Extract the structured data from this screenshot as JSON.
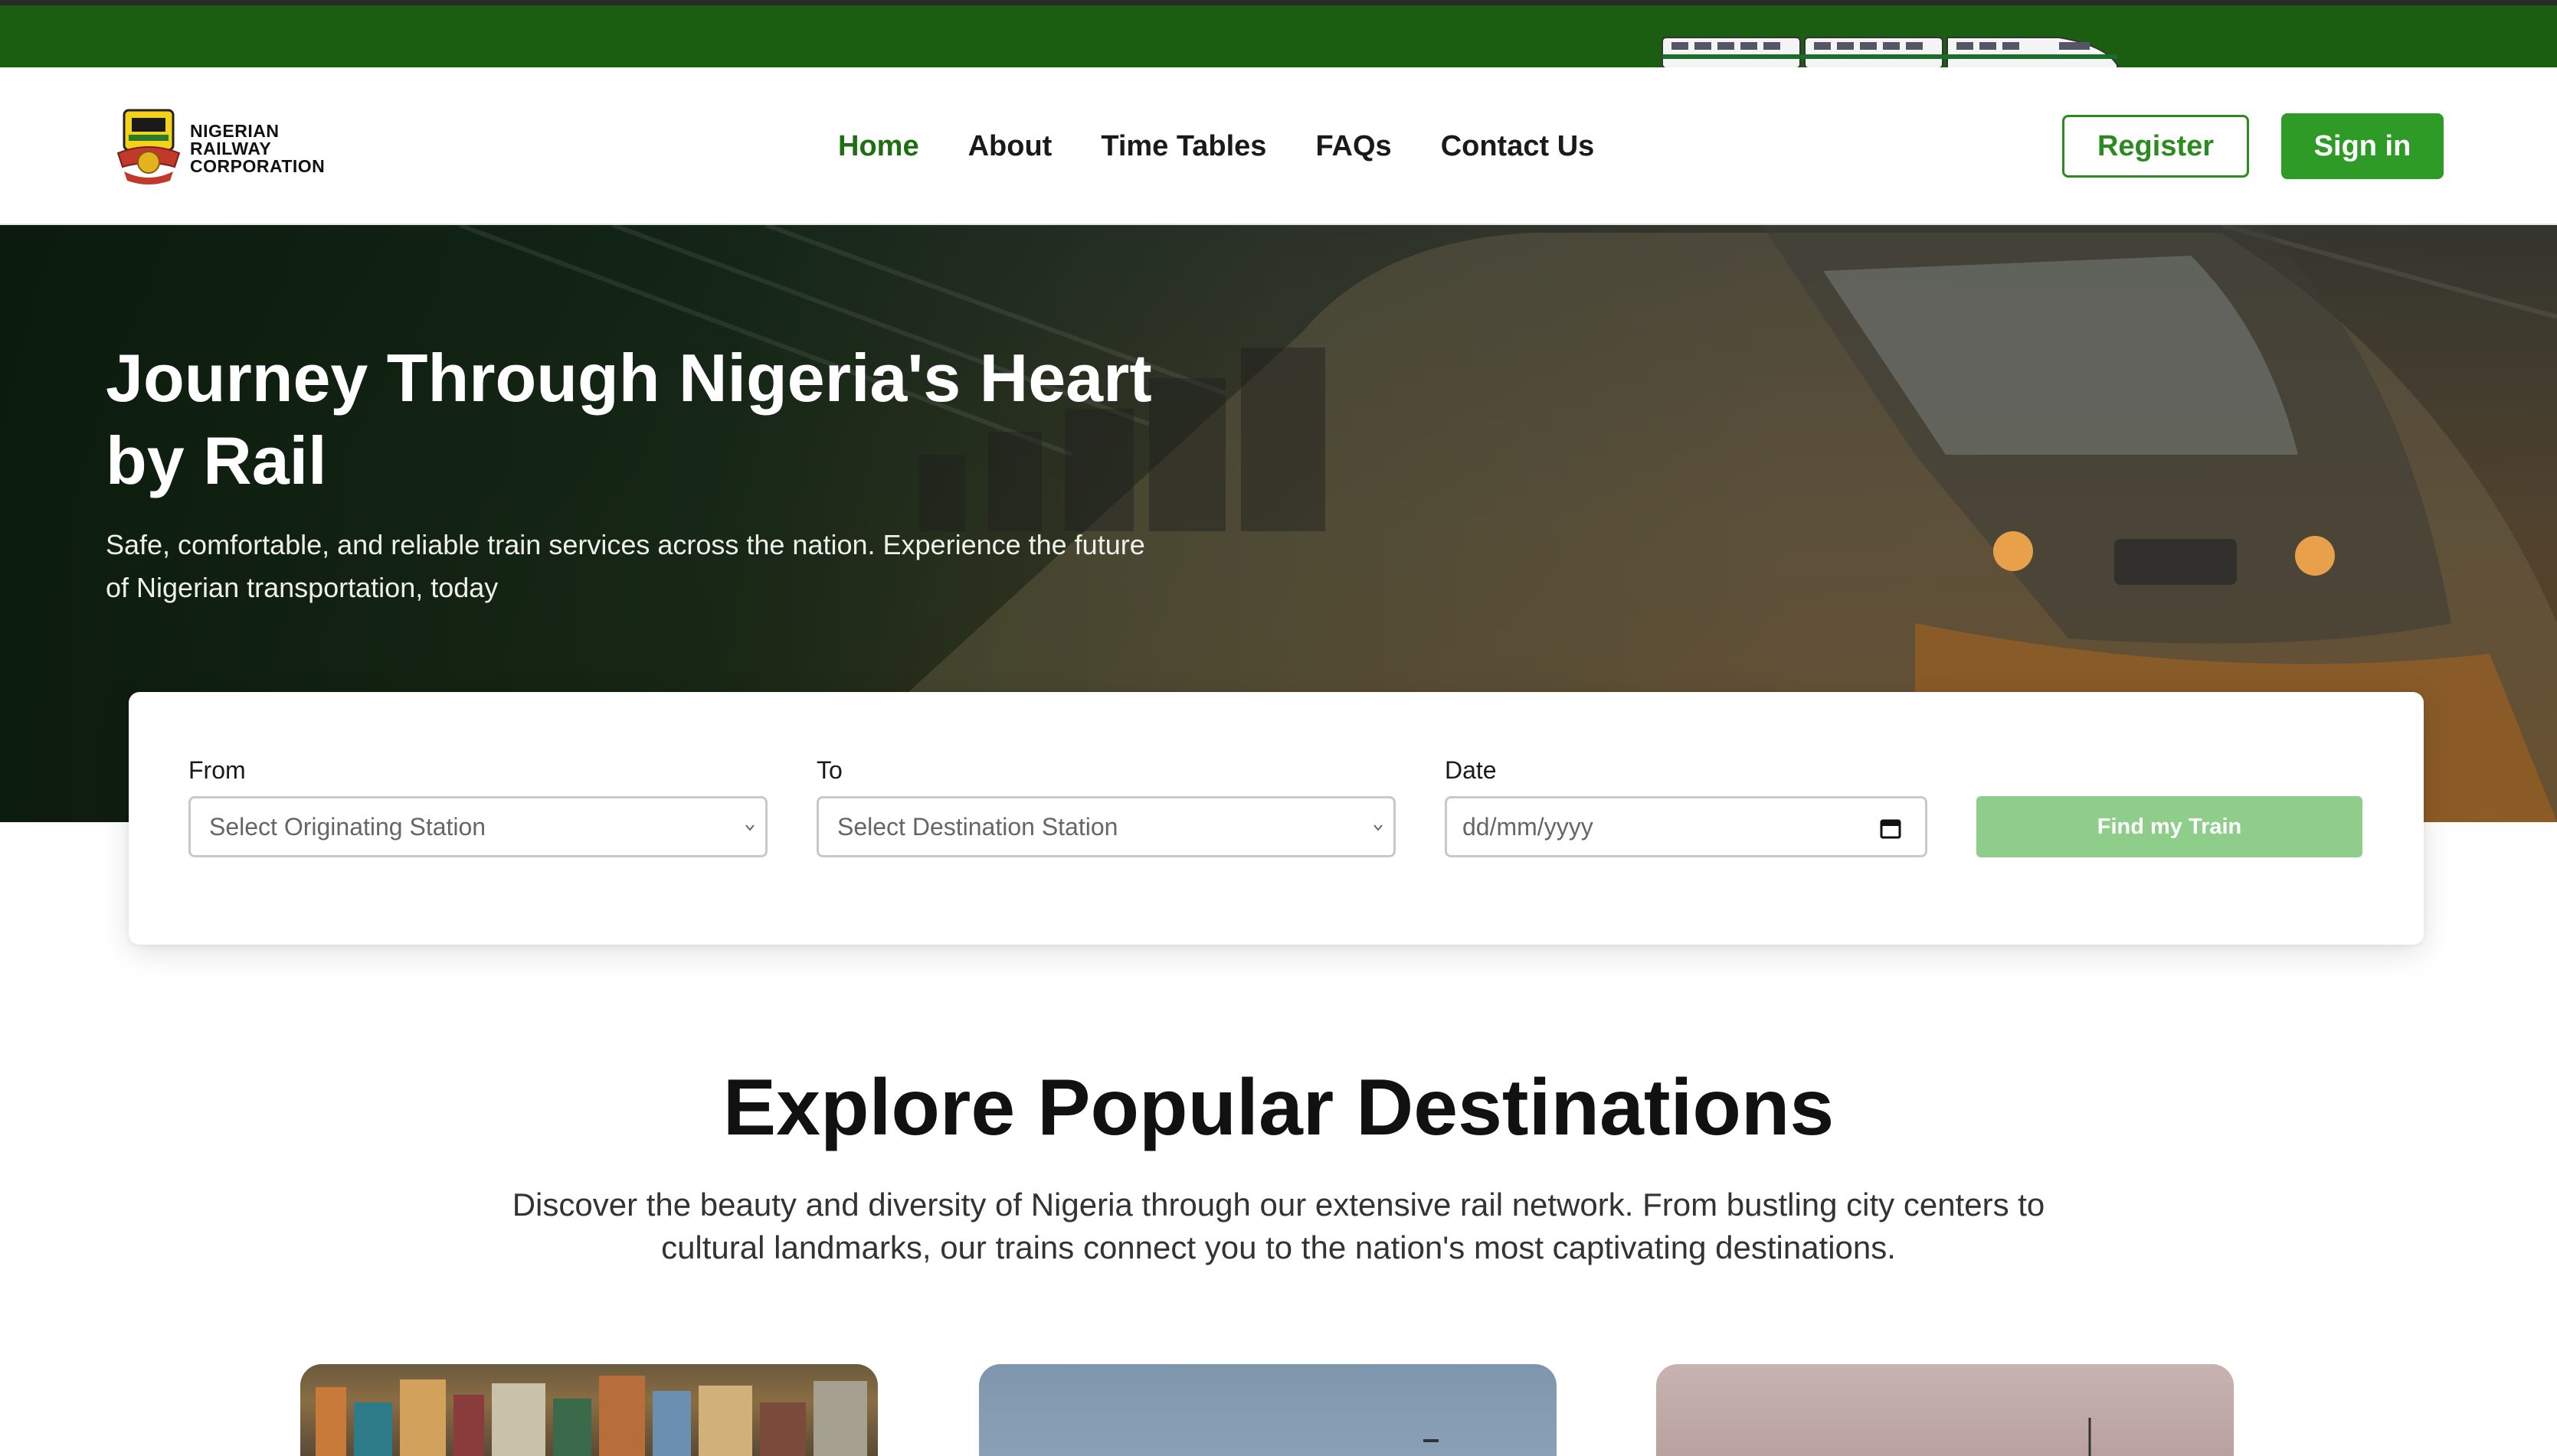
{
  "brand": {
    "logo_lines": [
      "NIGERIAN",
      "RAILWAY",
      "CORPORATION"
    ]
  },
  "nav": {
    "links": [
      {
        "label": "Home",
        "active": true
      },
      {
        "label": "About",
        "active": false
      },
      {
        "label": "Time Tables",
        "active": false
      },
      {
        "label": "FAQs",
        "active": false
      },
      {
        "label": "Contact Us",
        "active": false
      }
    ],
    "register_label": "Register",
    "signin_label": "Sign in"
  },
  "hero": {
    "title": "Journey Through Nigeria's Heart by Rail",
    "subtitle": "Safe, comfortable, and reliable train services across the nation. Experience the future of Nigerian transportation, today"
  },
  "search": {
    "from_label": "From",
    "from_value": "Select Originating Station",
    "to_label": "To",
    "to_value": "Select Destination Station",
    "date_label": "Date",
    "date_placeholder": "dd/mm/yyyy",
    "find_label": "Find my Train"
  },
  "destinations": {
    "title": "Explore Popular Destinations",
    "description": "Discover the beauty and diversity of Nigeria through our extensive rail network. From bustling city centers to cultural landmarks, our trains connect you to the nation's most captivating destinations."
  },
  "colors": {
    "brand_green": "#2d9b26",
    "topbar_green": "#1b5e12",
    "active_nav": "#1e6e12",
    "find_button": "#8fce8a"
  }
}
